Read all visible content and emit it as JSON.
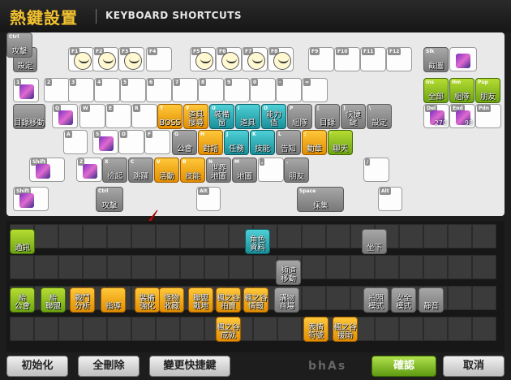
{
  "window": {
    "title_cn": "熱鍵設置",
    "title_en": "KEYBOARD SHORTCUTS"
  },
  "keyboard": {
    "slots": [
      {
        "key": "Esc",
        "label": "設定",
        "type": "gray"
      },
      {
        "key": "F1",
        "label": "",
        "type": "face"
      },
      {
        "key": "F2",
        "label": "",
        "type": "face"
      },
      {
        "key": "F3",
        "label": "",
        "type": "face"
      },
      {
        "key": "F4",
        "label": "",
        "type": "empty"
      },
      {
        "key": "F5",
        "label": "",
        "type": "face"
      },
      {
        "key": "F6",
        "label": "",
        "type": "face"
      },
      {
        "key": "F7",
        "label": "",
        "type": "face"
      },
      {
        "key": "F8",
        "label": "",
        "type": "face"
      },
      {
        "key": "F9",
        "label": "",
        "type": "empty"
      },
      {
        "key": "F10",
        "label": "",
        "type": "empty"
      },
      {
        "key": "F11",
        "label": "",
        "type": "empty"
      },
      {
        "key": "F12",
        "label": "",
        "type": "empty"
      },
      {
        "key": "Slk",
        "label": "截圖",
        "type": "gray"
      },
      {
        "key": "",
        "label": "",
        "type": "item"
      },
      {
        "key": "1",
        "label": "",
        "type": "item"
      },
      {
        "key": "2",
        "label": "",
        "type": "empty"
      },
      {
        "key": "3",
        "label": "",
        "type": "empty"
      },
      {
        "key": "4",
        "label": "",
        "type": "empty"
      },
      {
        "key": "5",
        "label": "",
        "type": "empty"
      },
      {
        "key": "6",
        "label": "",
        "type": "empty"
      },
      {
        "key": "7",
        "label": "",
        "type": "empty"
      },
      {
        "key": "8",
        "label": "",
        "type": "empty"
      },
      {
        "key": "9",
        "label": "",
        "type": "empty"
      },
      {
        "key": "0",
        "label": "",
        "type": "empty"
      },
      {
        "key": "-",
        "label": "",
        "type": "empty"
      },
      {
        "key": "=",
        "label": "",
        "type": "empty"
      },
      {
        "key": "Ins",
        "label": "全部",
        "type": "green"
      },
      {
        "key": "Hm",
        "label": "組隊",
        "type": "green"
      },
      {
        "key": "Pup",
        "label": "朋友",
        "type": "green"
      },
      {
        "key": "",
        "label": "目錄移動",
        "type": "gray"
      },
      {
        "key": "Q",
        "label": "",
        "type": "item"
      },
      {
        "key": "W",
        "label": "",
        "type": "empty"
      },
      {
        "key": "E",
        "label": "",
        "type": "empty"
      },
      {
        "key": "R",
        "label": "",
        "type": "empty"
      },
      {
        "key": "T",
        "label": "BOSS",
        "type": "orange"
      },
      {
        "key": "Y",
        "label": "道具\n搜尋",
        "type": "orange"
      },
      {
        "key": "U",
        "label": "裝備\n窗",
        "type": "teal"
      },
      {
        "key": "I",
        "label": "道具",
        "type": "teal"
      },
      {
        "key": "O",
        "label": "能力\n值",
        "type": "teal"
      },
      {
        "key": "P",
        "label": "組隊",
        "type": "gray"
      },
      {
        "key": "[",
        "label": "目錄",
        "type": "gray"
      },
      {
        "key": "]",
        "label": "快捷\n鍵",
        "type": "gray"
      },
      {
        "key": "\\",
        "label": "設定",
        "type": "gray"
      },
      {
        "key": "Del",
        "label": "270",
        "type": "item"
      },
      {
        "key": "End",
        "label": "98",
        "type": "item"
      },
      {
        "key": "Pdn",
        "label": "",
        "type": "empty"
      },
      {
        "key": "A",
        "label": "",
        "type": "empty"
      },
      {
        "key": "S",
        "label": "",
        "type": "item"
      },
      {
        "key": "D",
        "label": "",
        "type": "empty"
      },
      {
        "key": "F",
        "label": "",
        "type": "empty"
      },
      {
        "key": "G",
        "label": "公會",
        "type": "gray"
      },
      {
        "key": "H",
        "label": "對話",
        "type": "orange"
      },
      {
        "key": "J",
        "label": "任務",
        "type": "teal"
      },
      {
        "key": "K",
        "label": "技能",
        "type": "teal"
      },
      {
        "key": "L",
        "label": "告知",
        "type": "gray"
      },
      {
        "key": ";",
        "label": "勳章",
        "type": "orange"
      },
      {
        "key": "'",
        "label": "聊天",
        "type": "green"
      },
      {
        "key": "Shift",
        "label": "",
        "type": "item"
      },
      {
        "key": "Z",
        "label": "",
        "type": "item"
      },
      {
        "key": "X",
        "label": "撿起",
        "type": "gray"
      },
      {
        "key": "C",
        "label": "跳躍",
        "type": "gray"
      },
      {
        "key": "V",
        "label": "活動",
        "type": "orange"
      },
      {
        "key": "B",
        "label": "技能",
        "type": "orange"
      },
      {
        "key": "N",
        "label": "世界\n地圖",
        "type": "gray"
      },
      {
        "key": "M",
        "label": "地圖",
        "type": "gray"
      },
      {
        "key": ",",
        "label": "",
        "type": "empty"
      },
      {
        "key": ".",
        "label": "朋友",
        "type": "gray"
      },
      {
        "key": "/",
        "label": "",
        "type": "empty"
      },
      {
        "key": "Shift",
        "label": "",
        "type": "item"
      },
      {
        "key": "Ctrl",
        "label": "攻擊",
        "type": "gray"
      },
      {
        "key": "Alt",
        "label": "",
        "type": "empty"
      },
      {
        "key": "Space",
        "label": "採集",
        "type": "gray"
      },
      {
        "key": "Alt",
        "label": "",
        "type": "empty"
      },
      {
        "key": "Ctrl",
        "label": "攻擊",
        "type": "gray"
      }
    ]
  },
  "palette": {
    "items": [
      {
        "label": "通訊",
        "type": "green"
      },
      {
        "label": "角色\n資料",
        "type": "teal"
      },
      {
        "label": "坐下",
        "type": "gray"
      },
      {
        "label": "頻道\n移動",
        "type": "gray"
      },
      {
        "label": "給\n公會",
        "type": "green"
      },
      {
        "label": "給\n聯盟",
        "type": "green"
      },
      {
        "label": "戰鬥\n分析",
        "type": "orange"
      },
      {
        "label": "指導",
        "type": "orange"
      },
      {
        "label": "裝備\n強化",
        "type": "orange"
      },
      {
        "label": "怪物\n收藏",
        "type": "orange"
      },
      {
        "label": "聯盟\n戰地",
        "type": "orange"
      },
      {
        "label": "楓之谷\n拍賣",
        "type": "orange"
      },
      {
        "label": "楓之谷\n情報",
        "type": "orange"
      },
      {
        "label": "購物\n商場",
        "type": "gray"
      },
      {
        "label": "拍照\n模式",
        "type": "gray"
      },
      {
        "label": "安全\n模式",
        "type": "gray"
      },
      {
        "label": "靜音",
        "type": "gray"
      },
      {
        "label": "楓之谷\n成就",
        "type": "orange"
      },
      {
        "label": "表情\n符號",
        "type": "orange"
      },
      {
        "label": "楓之谷\n援助",
        "type": "orange"
      }
    ]
  },
  "buttons": {
    "reset": "初始化",
    "delete_all": "全刪除",
    "change": "變更快捷鍵",
    "confirm": "確認",
    "cancel": "取消"
  },
  "colors": {
    "title": "#f2c230",
    "orange": "#f0a000",
    "teal": "#23a6b0",
    "green": "#8bbd1e",
    "gray": "#8e8e8e",
    "arrow": "#e01010"
  }
}
